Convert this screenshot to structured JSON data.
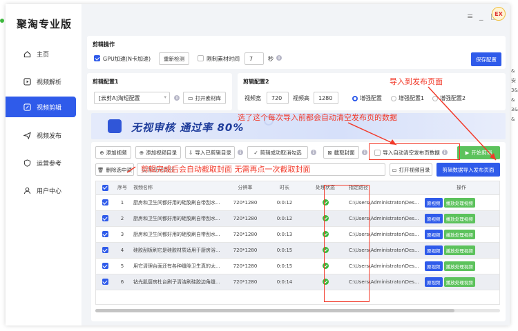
{
  "app": {
    "title": "聚淘专业版",
    "logo_text": "EX"
  },
  "window": {
    "menu": "≡",
    "minimize": "_",
    "maximize": "□"
  },
  "sidebar": {
    "items": [
      {
        "label": "主页",
        "icon": "home-icon"
      },
      {
        "label": "视频解析",
        "icon": "play-icon"
      },
      {
        "label": "视频剪辑",
        "icon": "edit-icon",
        "active": true
      },
      {
        "label": "视频发布",
        "icon": "send-icon"
      },
      {
        "label": "运营参考",
        "icon": "shield-icon"
      },
      {
        "label": "用户中心",
        "icon": "user-icon"
      }
    ]
  },
  "ops": {
    "title": "剪辑操作",
    "gpu_label": "GPU加速(N卡加速)",
    "recheck": "重新检测",
    "limit_label": "限制素材时间",
    "limit_value": "7",
    "seconds": "秒",
    "save": "保存配置"
  },
  "config1": {
    "title": "剪辑配置1",
    "select_value": "[云剪A]淘短配置",
    "open_lib": "打开素材库"
  },
  "config2": {
    "title": "剪辑配置2",
    "width_label": "视频宽",
    "width_value": "720",
    "height_label": "视频高",
    "height_value": "1280",
    "radios": [
      "增强配置",
      "增强配置1",
      "增强配置2"
    ]
  },
  "banner": {
    "text": "无视审核  通过率 80%"
  },
  "toolbar": {
    "add_video": "添加视频",
    "add_dir": "添加视频目录",
    "import_clip": "导入已剪辑目录",
    "auto_uncheck": "剪辑成功取消勾选",
    "cut_cover": "截取封面",
    "auto_clear": "导入自动清空发布页数据",
    "start": "开始剪辑",
    "delete_selected": "删除选中项",
    "path_placeholder": "设置视频路径",
    "open_dir": "打开视频目录",
    "import_publish": "剪辑数据导入发布页面"
  },
  "table": {
    "headers": [
      "序号",
      "视频名称",
      "分辨率",
      "时长",
      "处理状态",
      "指定路径",
      "操作"
    ],
    "rows": [
      {
        "no": "1",
        "name": "厨房和卫生间都好用的硅胶刷自带刮水...",
        "res": "720*1280",
        "dur": "0:0:12",
        "path": "C:\\Users\\Administrator\\Des..."
      },
      {
        "no": "2",
        "name": "厨房和卫生间都好用的硅胶刷自带刮水...",
        "res": "720*1280",
        "dur": "0:0:12",
        "path": "C:\\Users\\Administrator\\Des..."
      },
      {
        "no": "3",
        "name": "厨房和卫生间都好用的硅胶刷自带刮水...",
        "res": "720*1280",
        "dur": "0:0:13",
        "path": "C:\\Users\\Administrator\\Des..."
      },
      {
        "no": "4",
        "name": "硅胶刮板刷它是硅胶材质适用于厨房浴...",
        "res": "720*1280",
        "dur": "0:0:15",
        "path": "C:\\Users\\Administrator\\Des..."
      },
      {
        "no": "5",
        "name": "用它清理台面还有各种缝隙卫生真的太...",
        "res": "720*1280",
        "dur": "0:0:15",
        "path": "C:\\Users\\Administrator\\Des..."
      },
      {
        "no": "6",
        "name": "钻光肌厨房杜台刷子清洁刷硅胶边角缝...",
        "res": "720*1280",
        "dur": "0:0:14",
        "path": "C:\\Users\\Administrator\\Des..."
      }
    ],
    "op_original": "原视频",
    "op_processed": "播放处理视频"
  },
  "annotations": {
    "import_to_publish": "导入到发布页面",
    "auto_clear_note": "选了这个每次导入前都会自动清空发布页的数据",
    "cover_note": "剪辑完成后会自动截取封面 无需再点一次截取封面"
  },
  "edge_text": [
    "&安",
    "3&",
    "&",
    "3&",
    "&"
  ],
  "colors": {
    "primary": "#2f5bea",
    "green": "#5cc25c",
    "annotation": "#f23a2a"
  }
}
